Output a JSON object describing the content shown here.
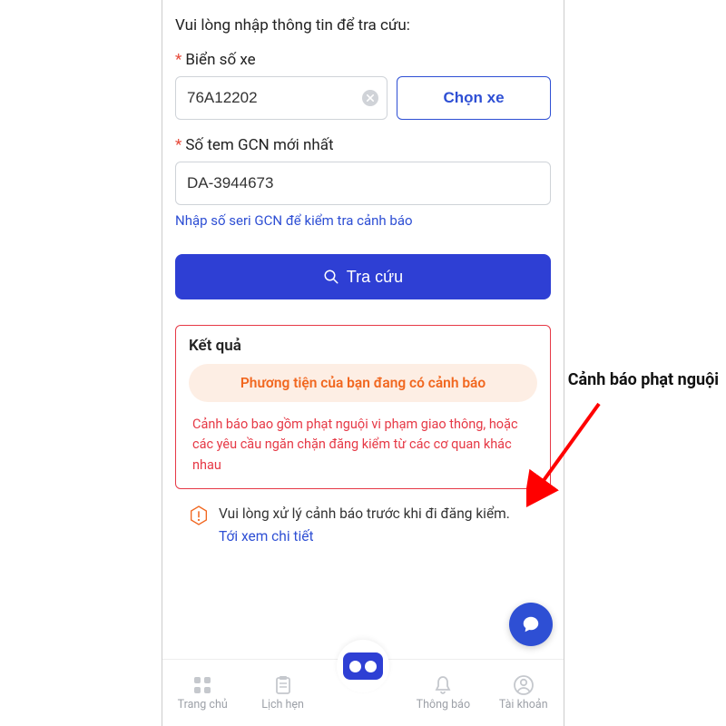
{
  "form": {
    "prompt": "Vui lòng nhập thông tin để tra cứu:",
    "plate_label": "Biển số xe",
    "plate_value": "76A12202",
    "select_vehicle_label": "Chọn xe",
    "gcn_label": "Số tem GCN mới nhất",
    "gcn_value": "DA-3944673",
    "gcn_hint": "Nhập số seri GCN để kiểm tra cảnh báo",
    "search_label": "Tra cứu"
  },
  "result": {
    "title": "Kết quả",
    "warning_title": "Phương tiện của bạn đang có cảnh báo",
    "warning_detail": "Cảnh báo bao gồm phạt nguội vi phạm giao thông, hoặc các yêu cầu ngăn chặn đăng kiểm từ các cơ quan khác nhau"
  },
  "action": {
    "text": "Vui lòng xử lý cảnh báo trước khi đi đăng kiểm.",
    "link": "Tới xem chi tiết"
  },
  "tabs": {
    "home": "Trang chủ",
    "schedule": "Lịch hẹn",
    "notifications": "Thông báo",
    "account": "Tài khoản"
  },
  "annotation": {
    "label": "Cảnh báo phạt nguội"
  }
}
